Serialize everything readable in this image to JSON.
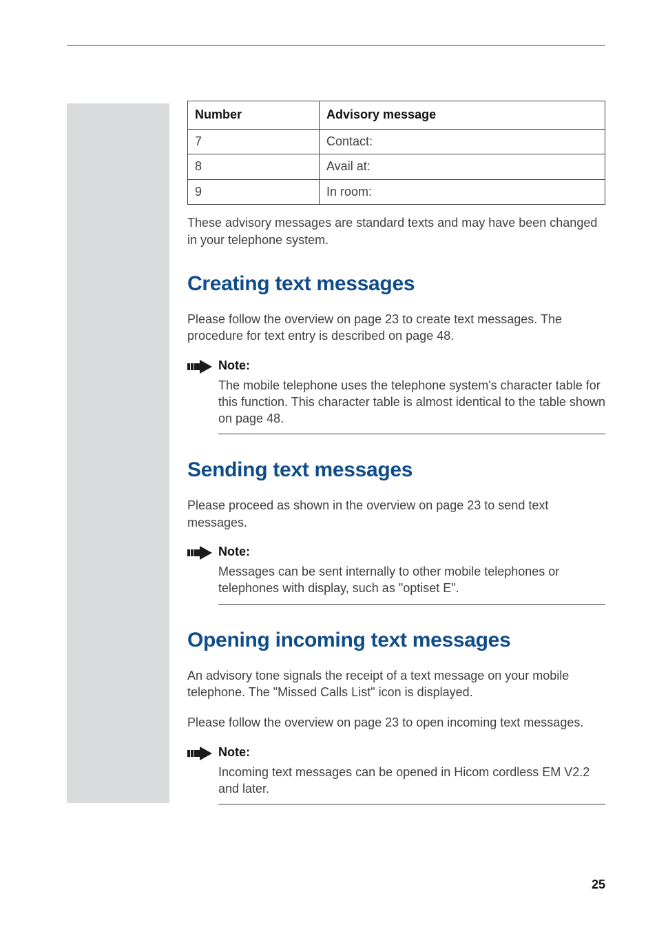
{
  "table": {
    "header_number": "Number",
    "header_msg": "Advisory message",
    "rows": [
      {
        "num": "7",
        "msg": "Contact:"
      },
      {
        "num": "8",
        "msg": "Avail at:"
      },
      {
        "num": "9",
        "msg": "In room:"
      }
    ]
  },
  "intro_after_table": "These advisory messages are standard texts and may have been changed in your telephone system.",
  "sections": {
    "creating": {
      "title": "Creating text messages",
      "body": "Please follow the overview on page 23 to create text messages. The procedure for text entry is described on page 48.",
      "note_title": "Note:",
      "note_body": "The mobile telephone uses the telephone system's character table for this function. This character table is almost identical to the table shown on page 48."
    },
    "sending": {
      "title": "Sending text messages",
      "body": "Please proceed as shown in the overview on page 23 to send text messages.",
      "note_title": "Note:",
      "note_body": "Messages can be sent internally to other mobile telephones or telephones with display, such as \"optiset E\"."
    },
    "opening": {
      "title": "Opening incoming text messages",
      "body1": "An advisory tone signals the receipt of a text message on your mobile telephone. The \"Missed Calls List\" icon is displayed.",
      "body2": "Please follow the overview on page 23 to open incoming text messages.",
      "note_title": "Note:",
      "note_body": "Incoming text messages can be opened in Hicom cordless EM V2.2 and later."
    }
  },
  "page_number": "25",
  "icons": {
    "note_arrow": "note-arrow-icon"
  }
}
